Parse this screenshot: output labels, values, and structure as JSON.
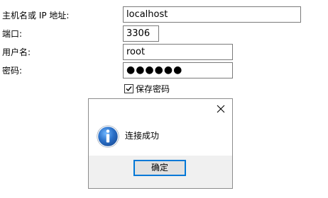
{
  "form": {
    "host_label": "主机名或 IP 地址:",
    "host_value": "localhost",
    "port_label": "端口:",
    "port_value": "3306",
    "user_label": "用户名:",
    "user_value": "root",
    "password_label": "密码:",
    "password_value": "●●●●●●",
    "save_password_label": "保存密码",
    "save_password_checked": true
  },
  "dialog": {
    "icon": "info-icon",
    "message": "连接成功",
    "ok_label": "确定",
    "close_icon": "close-icon"
  },
  "colors": {
    "accent": "#0078d7",
    "icon_blue": "#2a6fc7",
    "footer_bg": "#f0f0f0",
    "field_border": "#7a7a7a"
  }
}
